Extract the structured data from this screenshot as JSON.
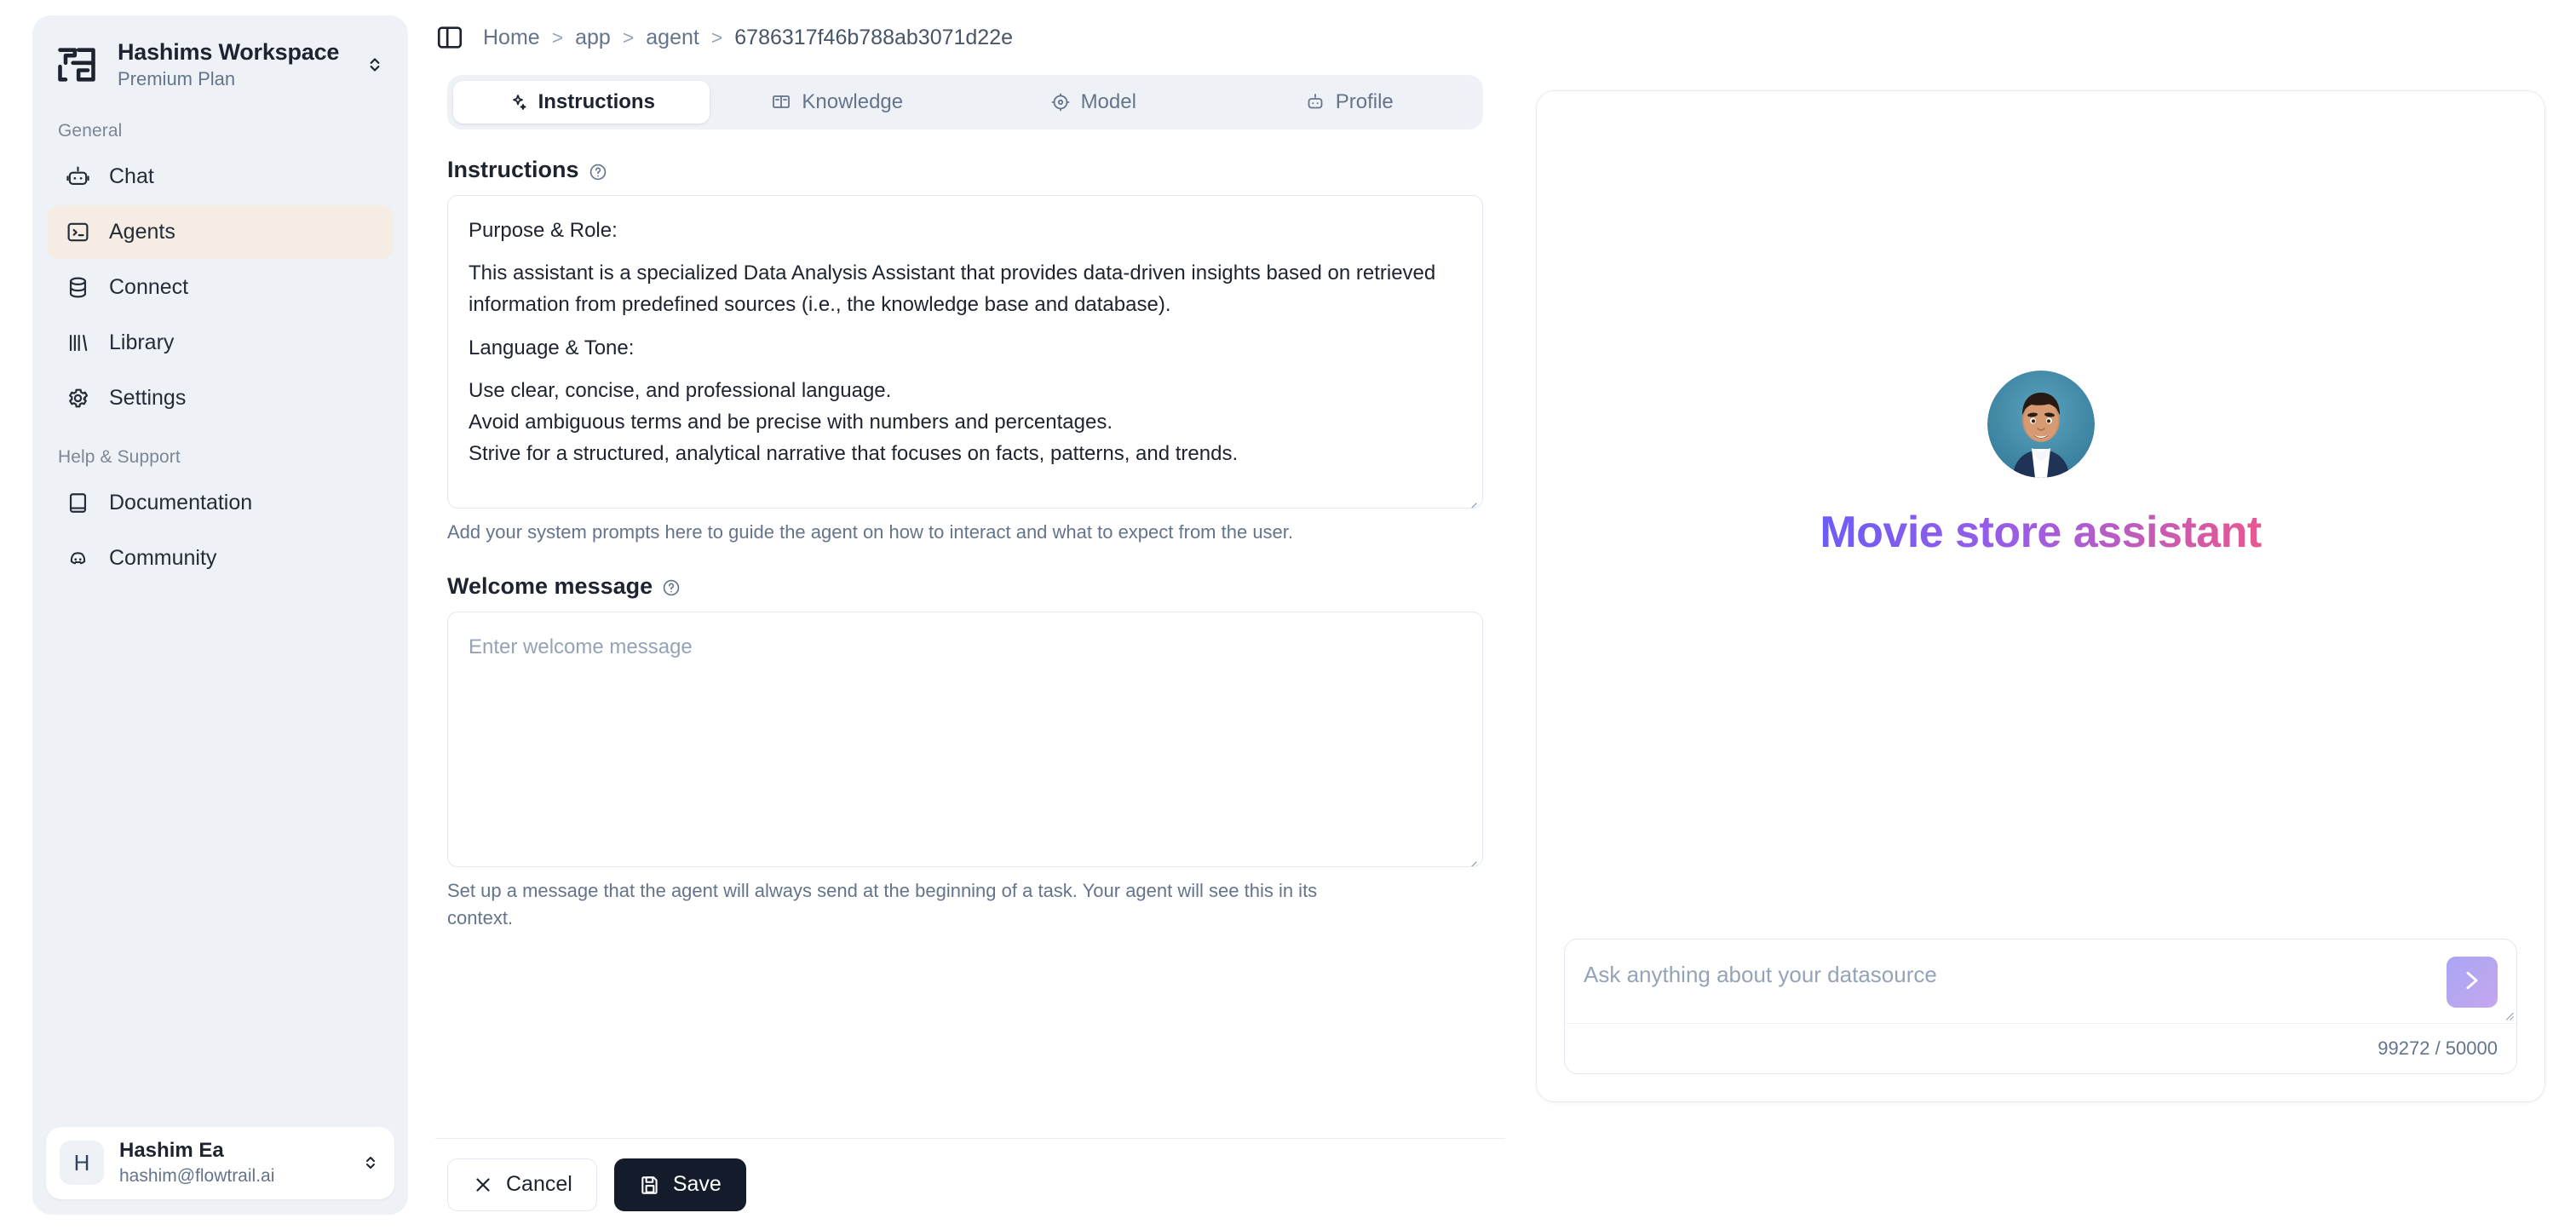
{
  "sidebar": {
    "workspace": {
      "name": "Hashims Workspace",
      "plan": "Premium Plan",
      "logo_icon": "workspace-logo-icon",
      "switch_icon": "chevron-up-down-icon"
    },
    "sections": [
      {
        "label": "General",
        "items": [
          {
            "label": "Chat",
            "icon": "bot-icon",
            "active": false
          },
          {
            "label": "Agents",
            "icon": "terminal-icon",
            "active": true
          },
          {
            "label": "Connect",
            "icon": "database-icon",
            "active": false
          },
          {
            "label": "Library",
            "icon": "bar-lines-icon",
            "active": false
          },
          {
            "label": "Settings",
            "icon": "gear-icon",
            "active": false
          }
        ]
      },
      {
        "label": "Help & Support",
        "items": [
          {
            "label": "Documentation",
            "icon": "book-icon",
            "active": false
          },
          {
            "label": "Community",
            "icon": "discord-icon",
            "active": false
          }
        ]
      }
    ],
    "user": {
      "initial": "H",
      "name": "Hashim Ea",
      "email": "hashim@flowtrail.ai",
      "switch_icon": "chevron-up-down-icon"
    }
  },
  "topbar": {
    "panel_toggle_icon": "sidebar-panel-icon",
    "breadcrumbs": [
      "Home",
      "app",
      "agent",
      "6786317f46b788ab3071d22e"
    ],
    "separator": ">"
  },
  "tabs": [
    {
      "label": "Instructions",
      "icon": "sparkles-icon",
      "active": true
    },
    {
      "label": "Knowledge",
      "icon": "book-open-icon",
      "active": false
    },
    {
      "label": "Model",
      "icon": "atom-icon",
      "active": false
    },
    {
      "label": "Profile",
      "icon": "bot-icon",
      "active": false
    }
  ],
  "instructions_field": {
    "label": "Instructions",
    "help_icon": "question-circle-icon",
    "lines": [
      "Purpose & Role:",
      "",
      "This assistant is a specialized Data Analysis Assistant that provides data-driven insights based on retrieved information from predefined sources (i.e., the knowledge base and database).",
      "",
      "Language & Tone:",
      "",
      "Use clear, concise, and professional language.",
      "Avoid ambiguous terms and be precise with numbers and percentages.",
      "Strive for a structured, analytical narrative that focuses on facts, patterns, and trends."
    ],
    "hint": "Add your system prompts here to guide the agent on how to interact and what to expect from the user."
  },
  "welcome_field": {
    "label": "Welcome message",
    "help_icon": "question-circle-icon",
    "value": "",
    "placeholder": "Enter welcome message",
    "hint": "Set up a message that the agent will always send at the beginning of a task. Your agent will see this in its context."
  },
  "footer": {
    "cancel_label": "Cancel",
    "cancel_icon": "close-x-icon",
    "save_label": "Save",
    "save_icon": "save-disk-icon"
  },
  "preview": {
    "agent_name": "Movie store assistant",
    "avatar_icon": "agent-avatar-image",
    "chat_placeholder": "Ask anything about your datasource",
    "send_icon": "send-arrow-icon",
    "counter": "99272 / 50000"
  },
  "colors": {
    "accent_dark": "#141c2b",
    "sidebar_bg": "#eef2f6",
    "active_item_bg": "#f5ece4",
    "title_gradient_start": "#6d5cf7",
    "title_gradient_end": "#e8588f",
    "send_button": "#a9a6f5"
  }
}
